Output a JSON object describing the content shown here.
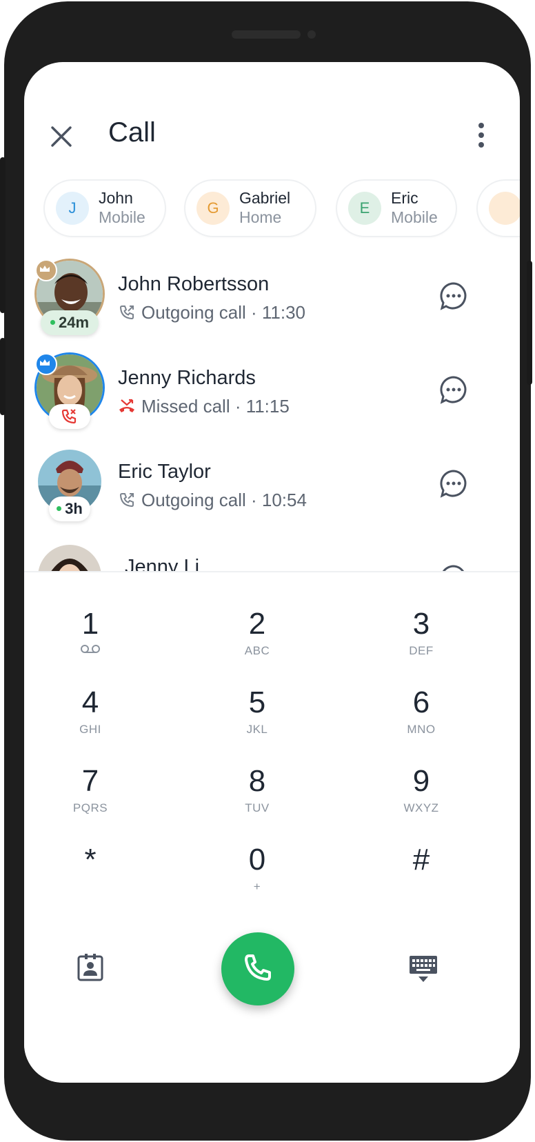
{
  "header": {
    "title": "Call"
  },
  "chips": [
    {
      "initial": "J",
      "name": "John",
      "type": "Mobile",
      "bg": "#e3f1fb",
      "fg": "#2a8fd8"
    },
    {
      "initial": "G",
      "name": "Gabriel",
      "type": "Home",
      "bg": "#fdebd6",
      "fg": "#e49a32"
    },
    {
      "initial": "E",
      "name": "Eric",
      "type": "Mobile",
      "bg": "#dff0e6",
      "fg": "#3aa370"
    }
  ],
  "calls": [
    {
      "name": "John Robertsson",
      "detail": "Outgoing call · 11:30",
      "badge": "24m",
      "kind": "outgoing"
    },
    {
      "name": "Jenny Richards",
      "detail": "Missed call · 11:15",
      "kind": "missed"
    },
    {
      "name": "Eric Taylor",
      "detail": "Outgoing call · 10:54",
      "badge": "3h",
      "kind": "outgoing"
    },
    {
      "name": "Jenny Li"
    }
  ],
  "dialpad": {
    "keys": [
      {
        "num": "1",
        "sub": ""
      },
      {
        "num": "2",
        "sub": "ABC"
      },
      {
        "num": "3",
        "sub": "DEF"
      },
      {
        "num": "4",
        "sub": "GHI"
      },
      {
        "num": "5",
        "sub": "JKL"
      },
      {
        "num": "6",
        "sub": "MNO"
      },
      {
        "num": "7",
        "sub": "PQRS"
      },
      {
        "num": "8",
        "sub": "TUV"
      },
      {
        "num": "9",
        "sub": "WXYZ"
      },
      {
        "num": "*",
        "sub": ""
      },
      {
        "num": "0",
        "sub": "+"
      },
      {
        "num": "#",
        "sub": ""
      }
    ]
  },
  "colors": {
    "accent_green": "#22b864",
    "missed_red": "#e53935",
    "premium_gold": "#c9a677",
    "premium_blue": "#1f86ea",
    "text_primary": "#1f2733",
    "text_secondary": "#5e6672"
  },
  "icons": {
    "close": "close-icon",
    "more": "more-vertical-icon",
    "message": "message-bubble-icon",
    "outgoing": "outgoing-call-icon",
    "missed": "missed-call-icon",
    "voicemail": "voicemail-icon",
    "call": "phone-icon",
    "contacts": "contact-card-icon",
    "keyboard": "keyboard-icon"
  }
}
